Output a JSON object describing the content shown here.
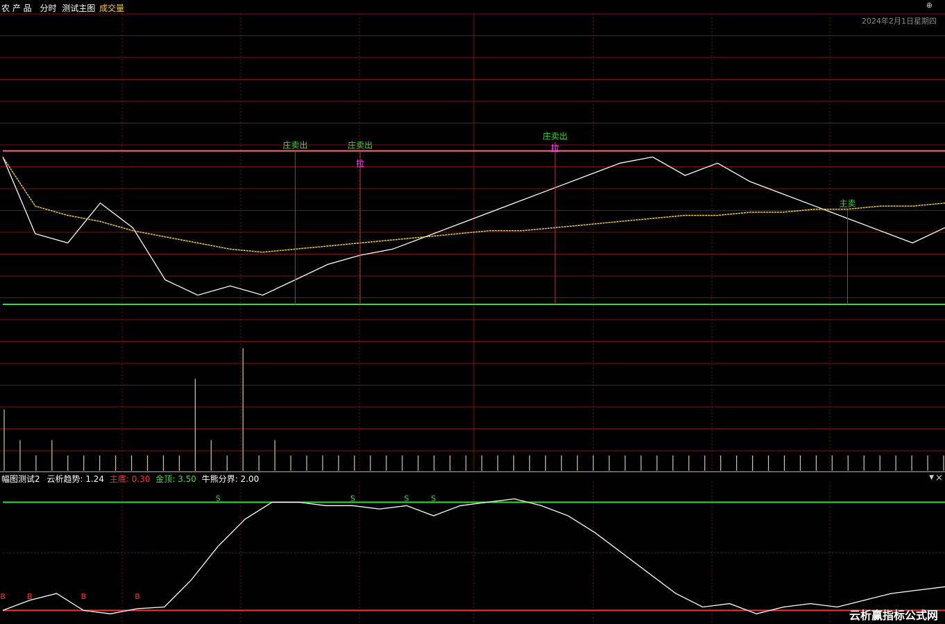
{
  "header": {
    "stock_name": "农 产 品",
    "mode": "分时",
    "main_indicator": "测试主图",
    "volume_label": "成交量",
    "date": "2024年2月1日星期四"
  },
  "sub_header": {
    "indicator": "幅图测试2",
    "items": [
      {
        "label": "云析趋势:",
        "value": "1.24",
        "label_color": "#ffffff",
        "value_color": "#ffffff"
      },
      {
        "label": "主底:",
        "value": "0.30",
        "label_color": "#ff3030",
        "value_color": "#ff3030"
      },
      {
        "label": "金顶:",
        "value": "3.50",
        "label_color": "#33dd33",
        "value_color": "#33dd33"
      },
      {
        "label": "牛熊分界:",
        "value": "2.00",
        "label_color": "#ffffff",
        "value_color": "#ffffff"
      }
    ]
  },
  "buttons": {
    "top_right": "⊕",
    "dropdown": "▼",
    "close": "×"
  },
  "watermark": "云析赢指标公式网",
  "colors": {
    "grid": "#7a1212",
    "price": "#ffffff",
    "avg": "#f0d030",
    "resistance": "#ff6a6a",
    "support": "#33dd33",
    "volume": "#d8c890",
    "osc_top": "#33dd33",
    "osc_bottom": "#ff3030",
    "marker_text": "#ff44ff",
    "signal_label": "#33dd33"
  },
  "chart_data": [
    {
      "type": "line",
      "series": [
        {
          "values": [
            100,
            97.5,
            97.2,
            98.5,
            97.7,
            96,
            95.5,
            95.8,
            95.5,
            96,
            96.5,
            96.8,
            97,
            97.4,
            97.8,
            98.2,
            98.6,
            99,
            99.4,
            99.8,
            100,
            99.4,
            99.8,
            99.2,
            98.8,
            98.4,
            98,
            97.6,
            97.2,
            97.7
          ]
        },
        {
          "values": [
            100,
            98.4,
            98.1,
            97.9,
            97.6,
            97.4,
            97.2,
            97,
            96.9,
            97,
            97.1,
            97.2,
            97.3,
            97.4,
            97.5,
            97.6,
            97.6,
            97.7,
            97.8,
            97.9,
            98,
            98.1,
            98.1,
            98.2,
            98.2,
            98.3,
            98.3,
            98.4,
            98.4,
            98.5
          ]
        }
      ],
      "reference_lines": [
        100.2,
        95.2
      ],
      "markers": [
        {
          "label": "庄卖出",
          "x": 9,
          "y": 100.2
        },
        {
          "label": "庄卖出",
          "x": 11,
          "y": 100.2
        },
        {
          "label": "庄卖出",
          "x": 17,
          "y": 100.5
        },
        {
          "label": "拉",
          "x": 11,
          "y": 99.6
        },
        {
          "label": "拉",
          "x": 17,
          "y": 100.1
        },
        {
          "label": "主卖",
          "x": 26,
          "y": 98.3
        }
      ]
    },
    {
      "type": "bar",
      "values": [
        4,
        2,
        1,
        2,
        1,
        1,
        1,
        1,
        1,
        1,
        1,
        1,
        6,
        2,
        1,
        8,
        1,
        2,
        1,
        1,
        1,
        1,
        1,
        1,
        1,
        1,
        1,
        1,
        1,
        1,
        1,
        1,
        1,
        1,
        1,
        1,
        1,
        1,
        1,
        1,
        1,
        1,
        1,
        1,
        1,
        1,
        1,
        1,
        1,
        1,
        1,
        1,
        1,
        1,
        1,
        1,
        1,
        1,
        1,
        1
      ]
    },
    {
      "type": "line",
      "series": [
        {
          "values": [
            0.3,
            0.6,
            0.8,
            0.3,
            0.2,
            0.35,
            0.4,
            1.2,
            2.2,
            3.0,
            3.5,
            3.5,
            3.4,
            3.4,
            3.3,
            3.4,
            3.1,
            3.4,
            3.5,
            3.6,
            3.4,
            3.1,
            2.6,
            2.0,
            1.4,
            0.8,
            0.4,
            0.5,
            0.2,
            0.4,
            0.5,
            0.4,
            0.6,
            0.8,
            0.9,
            1.0
          ]
        }
      ],
      "reference_lines": [
        3.5,
        2.0,
        0.3
      ],
      "markers": [
        {
          "label": "B",
          "x": 0,
          "y": 0.6
        },
        {
          "label": "B",
          "x": 1,
          "y": 0.6
        },
        {
          "label": "B",
          "x": 3,
          "y": 0.6
        },
        {
          "label": "B",
          "x": 5,
          "y": 0.6
        },
        {
          "label": "S",
          "x": 8,
          "y": 3.5
        },
        {
          "label": "S",
          "x": 13,
          "y": 3.5
        },
        {
          "label": "S",
          "x": 15,
          "y": 3.5
        },
        {
          "label": "S",
          "x": 16,
          "y": 3.5
        }
      ]
    }
  ]
}
